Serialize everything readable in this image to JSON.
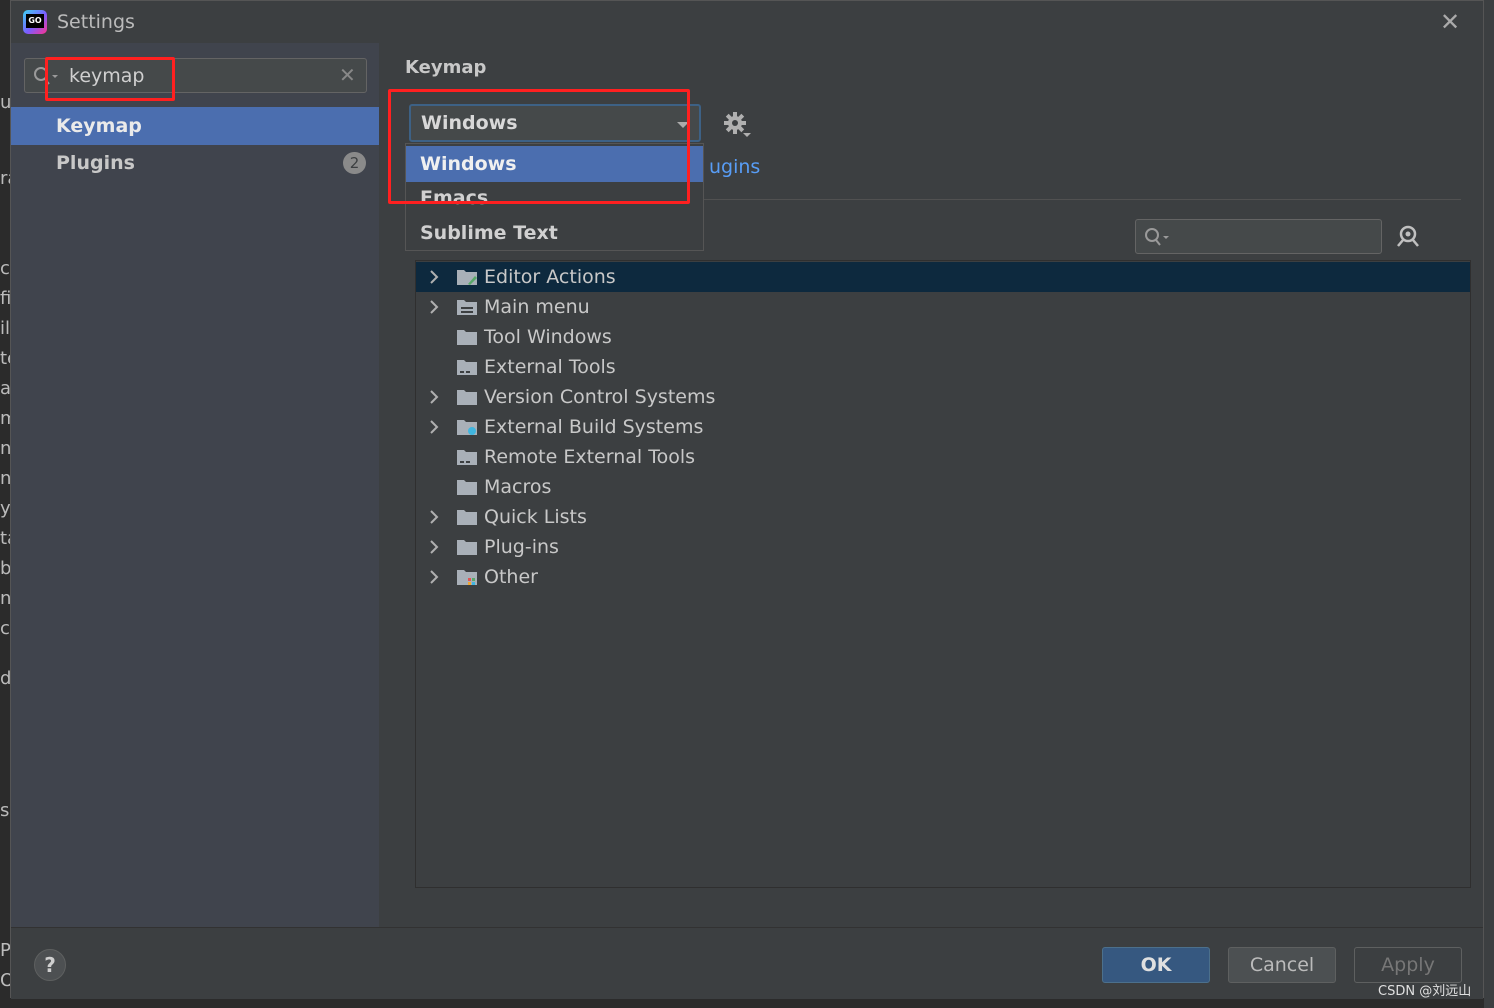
{
  "window": {
    "title": "Settings"
  },
  "sidebar": {
    "search": {
      "value": "keymap"
    },
    "items": [
      {
        "label": "Keymap",
        "selected": true
      },
      {
        "label": "Plugins",
        "badge": "2"
      }
    ]
  },
  "main": {
    "section_title": "Keymap",
    "keymap_select": {
      "value": "Windows"
    },
    "dropdown_options": [
      "Windows",
      "Emacs",
      "Sublime Text"
    ],
    "plugins_link": "ugins",
    "tree": [
      {
        "label": "Editor Actions",
        "expandable": true,
        "selected": true,
        "icon": "editor-actions-folder"
      },
      {
        "label": "Main menu",
        "expandable": true,
        "icon": "menu-folder"
      },
      {
        "label": "Tool Windows",
        "expandable": false,
        "icon": "folder"
      },
      {
        "label": "External Tools",
        "expandable": false,
        "icon": "tools-folder"
      },
      {
        "label": "Version Control Systems",
        "expandable": true,
        "icon": "folder"
      },
      {
        "label": "External Build Systems",
        "expandable": true,
        "icon": "gear-folder"
      },
      {
        "label": "Remote External Tools",
        "expandable": false,
        "icon": "tools-folder"
      },
      {
        "label": "Macros",
        "expandable": false,
        "icon": "folder"
      },
      {
        "label": "Quick Lists",
        "expandable": true,
        "icon": "folder"
      },
      {
        "label": "Plug-ins",
        "expandable": true,
        "icon": "folder"
      },
      {
        "label": "Other",
        "expandable": true,
        "icon": "other-folder"
      }
    ]
  },
  "footer": {
    "help": "?",
    "ok": "OK",
    "cancel": "Cancel",
    "apply": "Apply"
  },
  "watermark": "CSDN @刘远山",
  "background_fragments": [
    "u",
    "ra",
    "ch",
    "fi",
    "il",
    "te",
    "ac",
    "m",
    "ni",
    "ni",
    "yp",
    "ta",
    "b",
    "nb",
    "cc",
    "d",
    "s",
    "Pr",
    "O"
  ],
  "colors": {
    "accent": "#4b6eaf",
    "highlight": "#ff2020",
    "link": "#589df6",
    "tree_selected": "#0d293e"
  }
}
